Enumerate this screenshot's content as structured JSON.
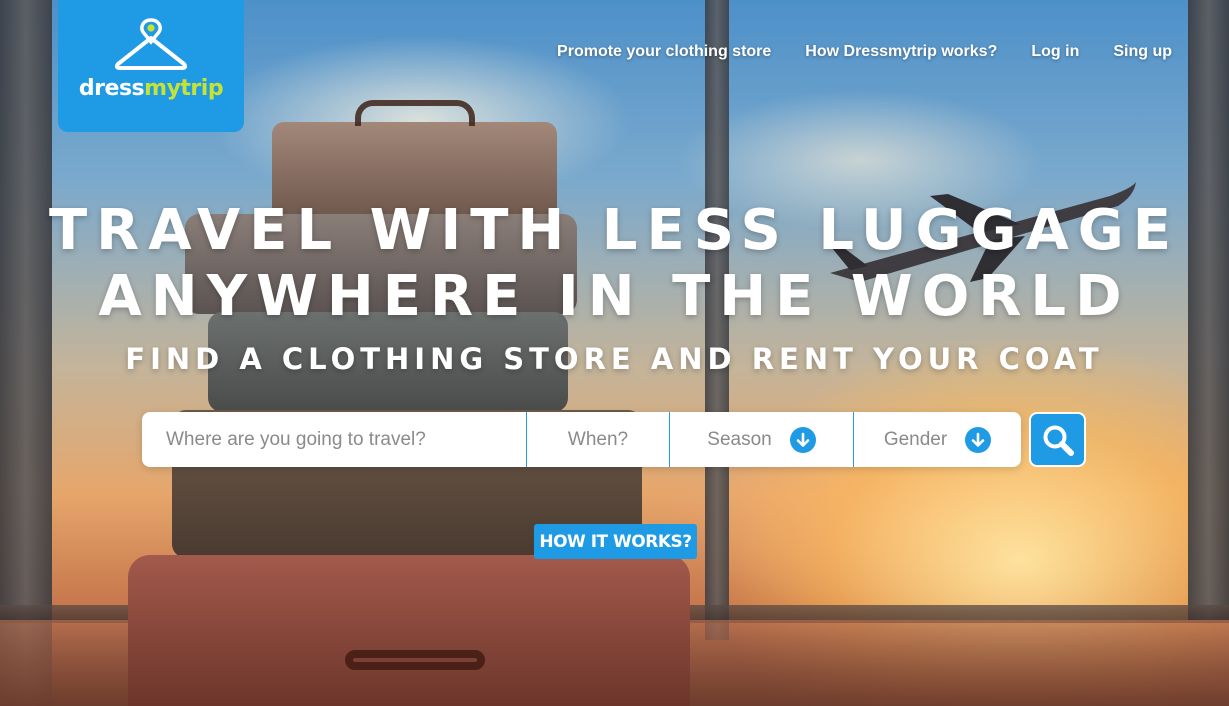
{
  "brand": {
    "name_part1": "dress",
    "name_part2": "mytrip",
    "accent_color": "#1f9be6",
    "highlight_color": "#c8e233",
    "icon": "hanger-pin-icon"
  },
  "nav": {
    "items": [
      {
        "label": "Promote your clothing store"
      },
      {
        "label": "How Dressmytrip works?"
      },
      {
        "label": "Log in"
      },
      {
        "label": "Sing up"
      }
    ]
  },
  "hero": {
    "headline_line1": "Travel with less luggage",
    "headline_line2": "anywhere in the world",
    "subheadline": "Find a clothing store and rent your coat"
  },
  "search": {
    "destination_placeholder": "Where are you going to travel?",
    "destination_value": "",
    "when_label": "When?",
    "season_label": "Season",
    "gender_label": "Gender",
    "dropdown_icon": "arrow-down-circle-icon",
    "search_icon": "search-icon"
  },
  "cta": {
    "how_it_works_label": "How it works?"
  }
}
